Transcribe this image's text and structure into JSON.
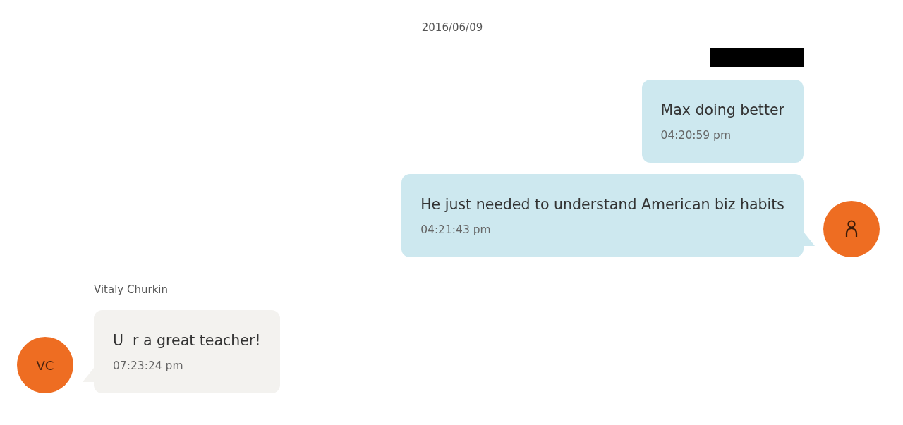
{
  "date": "2016/06/09",
  "messages": [
    {
      "kind": "outgoing",
      "sender_redacted": true,
      "text": "Max doing better",
      "time": "04:20:59 pm"
    },
    {
      "kind": "outgoing",
      "text": "He just needed to understand American biz habits",
      "time": "04:21:43 pm",
      "avatar": {
        "kind": "icon"
      }
    },
    {
      "kind": "incoming",
      "sender": "Vitaly Churkin",
      "text": "U  r a great teacher!",
      "time": "07:23:24 pm",
      "avatar": {
        "kind": "initials",
        "text": "VC"
      }
    }
  ]
}
